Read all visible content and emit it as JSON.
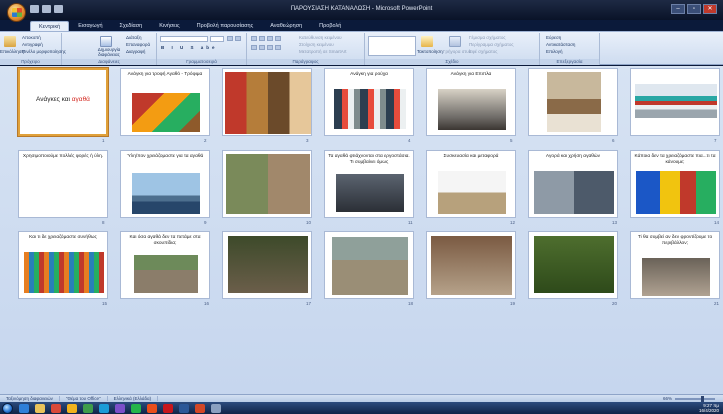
{
  "window": {
    "title": "ΠΑΡΟΥΣΙΑΣΗ ΚΑΤΑΝΑΛΩΣΗ - Microsoft PowerPoint",
    "minimize": "–",
    "maximize": "▫",
    "close": "✕"
  },
  "ribbon": {
    "tabs": [
      "Κεντρική",
      "Εισαγωγή",
      "Σχεδίαση",
      "Κινήσεις",
      "Προβολή παρουσίασης",
      "Αναθεώρηση",
      "Προβολή"
    ],
    "active_tab": 0,
    "groups": {
      "clipboard": {
        "label": "Πρόχειρο",
        "paste": "Επικόλληση",
        "cut": "Αποκοπή",
        "copy": "Αντιγραφή",
        "format_painter": "Πινέλο μορφοποίησης"
      },
      "slides": {
        "label": "Διαφάνειες",
        "new_slide": "Δημιουργία διαφάνειας",
        "layout": "Διάταξη",
        "reset": "Επαναφορά",
        "delete": "Διαγραφή"
      },
      "font": {
        "label": "Γραμματοσειρά"
      },
      "paragraph": {
        "label": "Παράγραφος",
        "text_direction": "Κατεύθυνση κειμένου",
        "align_text": "Στοίχιση κειμένου",
        "smartart": "Μετατροπή σε SmartArt"
      },
      "drawing": {
        "label": "Σχέδιο",
        "arrange": "Τακτοποίηση",
        "quick_styles": "Γρήγορα στυλ",
        "shape_fill": "Γέμισμα σχήματος",
        "shape_outline": "Περίγραμμα σχήματος",
        "shape_effects": "Εφέ σχήματος"
      },
      "editing": {
        "label": "Επεξεργασία",
        "find": "Εύρεση",
        "replace": "Αντικατάσταση",
        "select": "Επιλογή"
      }
    }
  },
  "slides": [
    {
      "n": "1",
      "title_pre": "Ανάγκες και ",
      "title_hl": "αγαθά",
      "title_main": true,
      "selected": true
    },
    {
      "n": "2",
      "title": "Ανάγκη για τροφή Αγαθό - Τρόφιμα",
      "img": "food"
    },
    {
      "n": "3",
      "title": "",
      "img": "food2"
    },
    {
      "n": "4",
      "title": "Ανάγκη για ρούχα",
      "img": "clothes"
    },
    {
      "n": "5",
      "title": "Ανάγκη για Επιπλα",
      "img": "furniture"
    },
    {
      "n": "6",
      "title": "",
      "img": "room"
    },
    {
      "n": "7",
      "title": "",
      "img": "cars"
    },
    {
      "n": "8",
      "title": "Χρησιμοποιούμε πολλές φορές ή ύλη.",
      "img": ""
    },
    {
      "n": "9",
      "title": "Ύλη/πον χρειάζομαστε για τα αγαθά",
      "img": "oil"
    },
    {
      "n": "10",
      "title": "",
      "img": "materials"
    },
    {
      "n": "11",
      "title": "Τα αγαθά φτιάχνονται στα εργοστάσια. Τι συμβαίνει όμως",
      "img": "factory"
    },
    {
      "n": "12",
      "title": "Συσκευασία και μεταφορά",
      "img": "truck"
    },
    {
      "n": "13",
      "title": "Αγορά και χρήση αγαθών",
      "img": "market"
    },
    {
      "n": "14",
      "title": "Κάποια δεν τα χρειαζόμαστε πια...τι τα κάνουμε;",
      "img": "bags"
    },
    {
      "n": "15",
      "title": "Και τι δε χρειαζόμαστε συνήθως",
      "img": "bottles"
    },
    {
      "n": "16",
      "title": "Και όσα αγαθά δεν τα πετάμε στα σκουπίδια;",
      "img": "river"
    },
    {
      "n": "17",
      "title": "",
      "img": "trash"
    },
    {
      "n": "18",
      "title": "",
      "img": "field"
    },
    {
      "n": "19",
      "title": "",
      "img": "garbage"
    },
    {
      "n": "20",
      "title": "",
      "img": "forest"
    },
    {
      "n": "21",
      "title": "Ti θα συμβεί αν δεν φροντίζουμε το περιβάλλον;",
      "img": "garbage2"
    }
  ],
  "statusbar": {
    "view": "Ταξινόμηση διαφανειών",
    "theme": "\"Θέμα του Office\"",
    "language": "Ελληνικά (Ελλάδα)",
    "zoom": "66%"
  },
  "taskbar": {
    "time": "9:27 πμ",
    "date": "16/4/2020"
  }
}
